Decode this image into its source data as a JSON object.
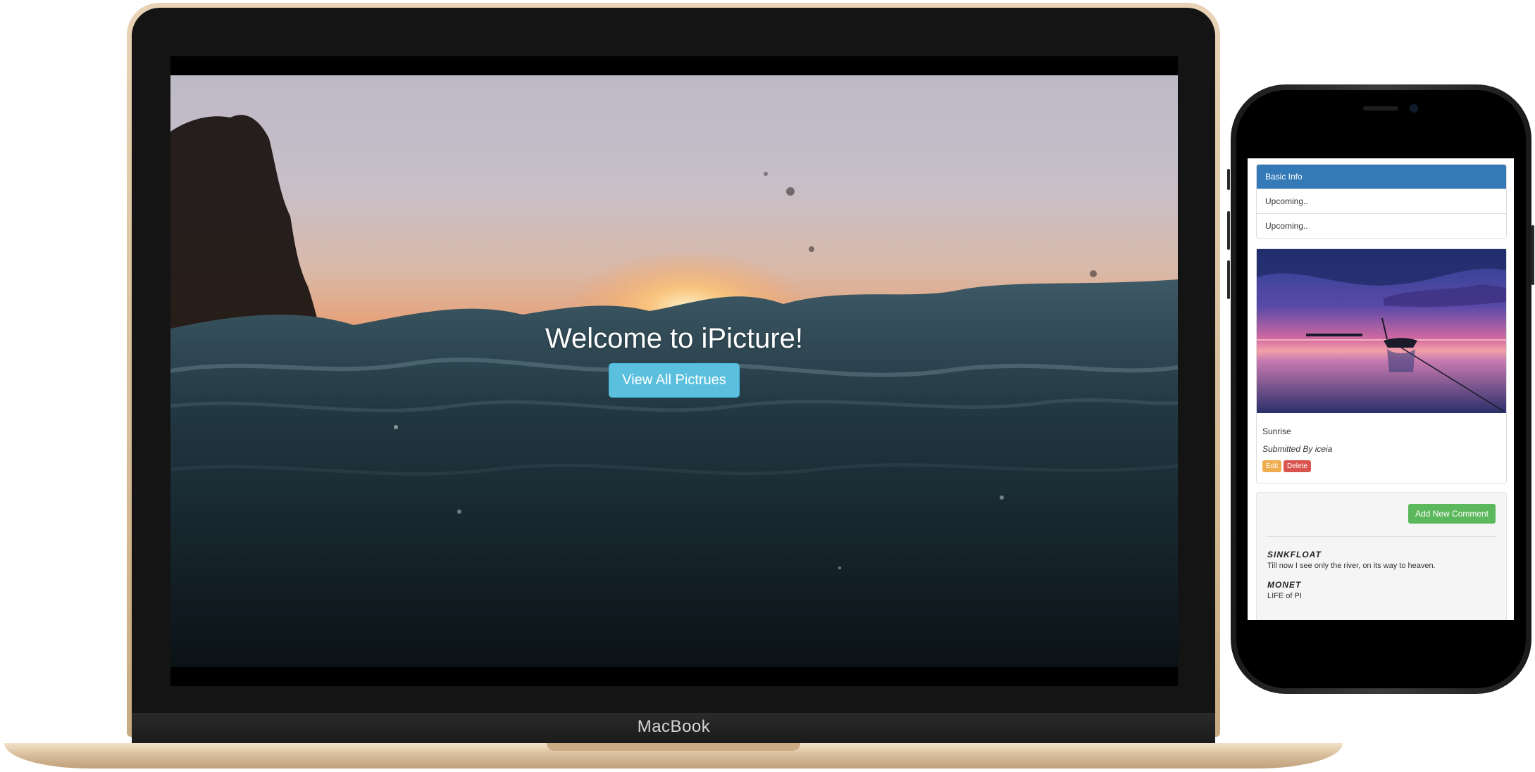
{
  "laptop": {
    "brand_label": "MacBook",
    "hero": {
      "title": "Welcome to iPicture!",
      "button_label": "View All Pictrues",
      "button_color": "#5bc0de"
    }
  },
  "phone": {
    "info_panel": {
      "heading": "Basic Info",
      "heading_color": "#337ab7",
      "items": [
        "Upcoming..",
        "Upcoming.."
      ]
    },
    "picture": {
      "title": "Sunrise",
      "submitted_by": "Submitted By iceia",
      "edit_label": "Edit",
      "delete_label": "Delete",
      "edit_color": "#f0ad4e",
      "delete_color": "#d9534f"
    },
    "comments": {
      "add_label": "Add New Comment",
      "add_color": "#5cb85c",
      "items": [
        {
          "author": "Sinkfloat",
          "text": "Till now I see only the river, on its way to heaven."
        },
        {
          "author": "Monet",
          "text": "LIFE of PI"
        }
      ]
    }
  }
}
